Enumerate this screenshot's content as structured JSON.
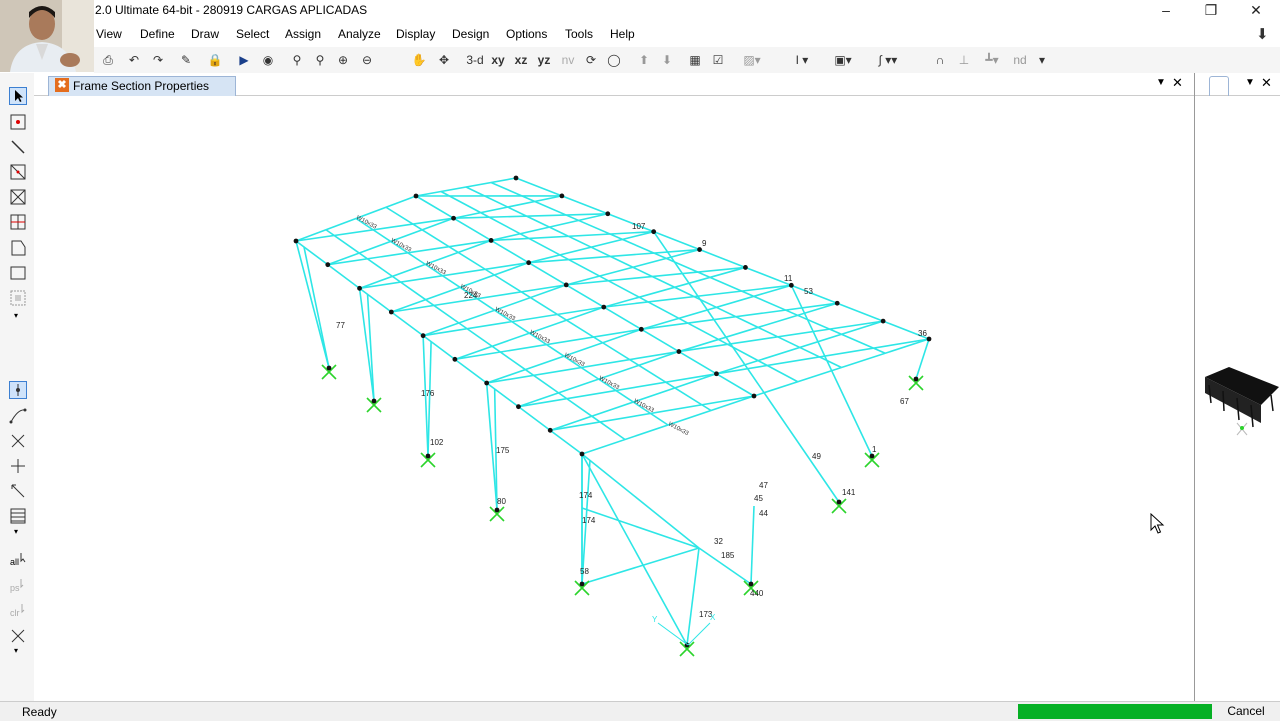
{
  "window": {
    "title": "2.0 Ultimate 64-bit - 280919  CARGAS APLICADAS"
  },
  "menu": [
    "View",
    "Define",
    "Draw",
    "Select",
    "Assign",
    "Analyze",
    "Display",
    "Design",
    "Options",
    "Tools",
    "Help"
  ],
  "toolbar": {
    "view_3d": "3-d",
    "view_xy": "xy",
    "view_xz": "xz",
    "view_yz": "yz",
    "view_nv": "nv",
    "nd_label": "nd"
  },
  "tab": {
    "label": "Frame Section Properties"
  },
  "status": {
    "text": "Ready",
    "cancel_label": "Cancel",
    "progress": 1.0
  },
  "model": {
    "section_label": "W10x33",
    "joint_labels": [
      "77",
      "174",
      "176",
      "102",
      "175",
      "80",
      "58",
      "173",
      "174",
      "32",
      "185",
      "440",
      "141",
      "67",
      "36",
      "53",
      "44",
      "45",
      "47",
      "49",
      "1",
      "107",
      "224",
      "9",
      "11"
    ],
    "colors": {
      "frames": "#2ee6e6",
      "supports": "#2bd42b",
      "joints": "#111111",
      "accent": "#06b025"
    }
  }
}
